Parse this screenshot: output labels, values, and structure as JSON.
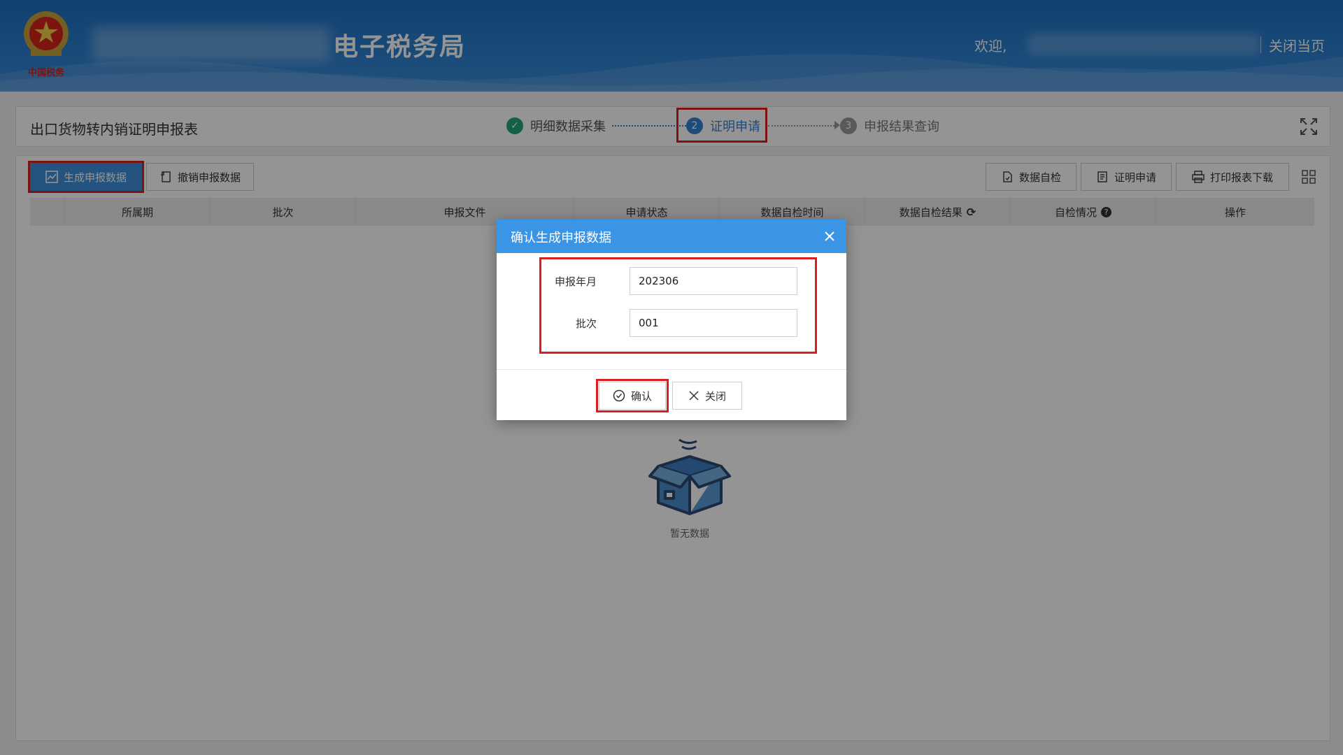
{
  "header": {
    "site_title": "电子税务局",
    "emblem_text": "中国税务",
    "welcome": "欢迎,",
    "close_page": "关闭当页"
  },
  "steps_panel": {
    "page_title": "出口货物转内销证明申报表",
    "steps": [
      {
        "num": "✓",
        "label": "明细数据采集",
        "status": "done"
      },
      {
        "num": "2",
        "label": "证明申请",
        "status": "active"
      },
      {
        "num": "3",
        "label": "申报结果查询",
        "status": "pending"
      }
    ]
  },
  "toolbar": {
    "generate_label": "生成申报数据",
    "revoke_label": "撤销申报数据",
    "self_check_label": "数据自检",
    "cert_apply_label": "证明申请",
    "print_label": "打印报表下载"
  },
  "table": {
    "columns": [
      "所属期",
      "批次",
      "申报文件",
      "申请状态",
      "数据自检时间",
      "数据自检结果",
      "自检情况",
      "操作"
    ],
    "empty_text": "暂无数据"
  },
  "dialog": {
    "title": "确认生成申报数据",
    "period_label": "申报年月",
    "period_value": "202306",
    "batch_label": "批次",
    "batch_value": "001",
    "confirm_label": "确认",
    "close_label": "关闭"
  },
  "colors": {
    "header_blue": "#2a7fcf",
    "primary": "#3d8fd9",
    "highlight_red": "#d9201e",
    "step_done": "#22a67a",
    "step_active": "#2f83d3"
  }
}
